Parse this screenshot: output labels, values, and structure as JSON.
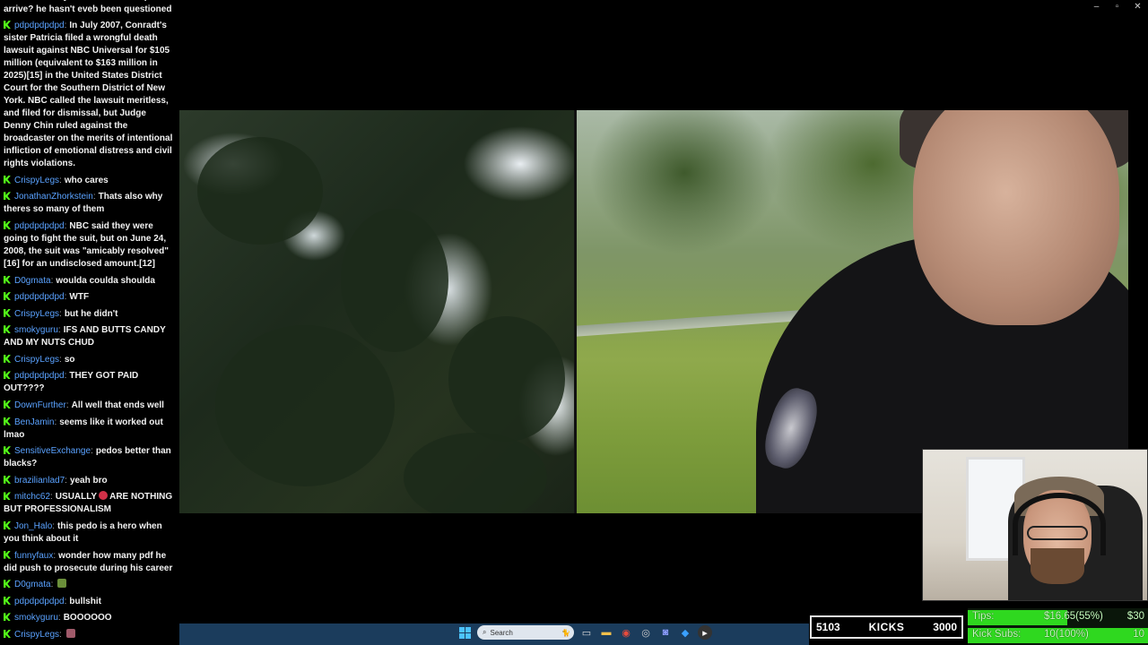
{
  "window_controls": {
    "minimize": "–",
    "maximize": "▫",
    "close": "✕"
  },
  "chat": {
    "messages": [
      {
        "user": "",
        "text": "he immediately do this when the police arrive? he hasn't eveb been questioned"
      },
      {
        "user": "pdpdpdpdpd",
        "text": "In July 2007, Conradt's sister Patricia filed a wrongful death lawsuit against NBC Universal for $105 million (equivalent to $163 million in 2025)[15] in the United States District Court for the Southern District of New York. NBC called the lawsuit meritless, and filed for dismissal, but Judge Denny Chin ruled against the broadcaster on the merits of intentional infliction of emotional distress and civil rights violations."
      },
      {
        "user": "CrispyLegs",
        "text": "who cares"
      },
      {
        "user": "JonathanZhorkstein",
        "text": "Thats also why theres so many of them"
      },
      {
        "user": "pdpdpdpdpd",
        "text": "NBC said they were going to fight the suit, but on June 24, 2008, the suit was \"amicably resolved\"[16] for an undisclosed amount.[12]"
      },
      {
        "user": "D0gmata",
        "text": "woulda coulda shoulda"
      },
      {
        "user": "pdpdpdpdpd",
        "text": "WTF"
      },
      {
        "user": "CrispyLegs",
        "text": "but he didn't"
      },
      {
        "user": "smokyguru",
        "text": "IFS AND BUTTS CANDY AND MY NUTS CHUD"
      },
      {
        "user": "CrispyLegs",
        "text": "so"
      },
      {
        "user": "pdpdpdpdpd",
        "text": "THEY GOT PAID OUT????"
      },
      {
        "user": "DownFurther",
        "text": "All well that ends well"
      },
      {
        "user": "BenJamin",
        "text": "seems like it worked out lmao"
      },
      {
        "user": "SensitiveExchange",
        "text": "pedos better than blacks?"
      },
      {
        "user": "brazilianlad7",
        "text": "yeah bro"
      },
      {
        "user": "mitchc62",
        "text": "USUALLY",
        "emote": "red",
        "text2": "ARE NOTHING BUT PROFESSIONALISM"
      },
      {
        "user": "Jon_Halo",
        "text": "this pedo is a hero when you think about it"
      },
      {
        "user": "funnyfaux",
        "text": "wonder how many pdf he did push to prosecute during his career"
      },
      {
        "user": "D0gmata",
        "text": "",
        "emote": "green"
      },
      {
        "user": "pdpdpdpdpd",
        "text": "bullshit"
      },
      {
        "user": "smokyguru",
        "text": "BOOOOOO"
      },
      {
        "user": "CrispyLegs",
        "text": "",
        "emote": "green"
      }
    ],
    "separator": ":"
  },
  "kicks_bar": {
    "left": "5103",
    "label": "KICKS",
    "right": "3000"
  },
  "tips_panel": {
    "tips_label": "Tips:",
    "tips_value": "$16.65(55%)",
    "tips_goal": "$30",
    "tips_progress": 0.55,
    "subs_label": "Kick Subs:",
    "subs_value": "10(100%)",
    "subs_goal": "10",
    "subs_progress": 1.0
  },
  "taskbar": {
    "search_placeholder": "Search",
    "icons": [
      "windows-start-icon",
      "search-icon",
      "cat-icon",
      "file-explorer-icon",
      "folder-icon",
      "chrome-icon",
      "obs-icon",
      "discord-icon",
      "browser-icon",
      "media-player-icon"
    ]
  },
  "colors": {
    "kick_green": "#53fc18",
    "username_blue": "#5aa2ff",
    "taskbar": "#1b3c5c",
    "tips_fill": "#2fd81f"
  }
}
